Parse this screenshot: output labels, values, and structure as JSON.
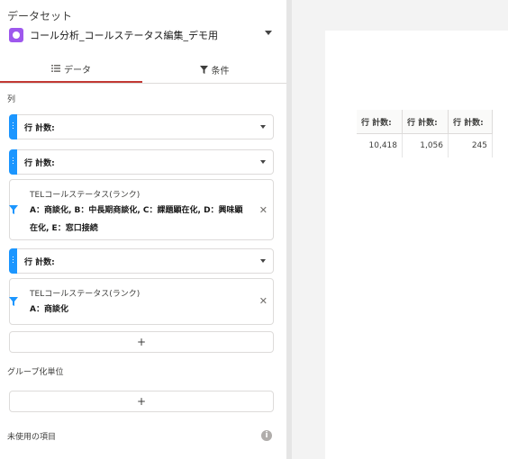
{
  "left_panel": {
    "dataset_label": "データセット",
    "dataset_name": "コール分析_コールステータス編集_デモ用",
    "tabs": [
      {
        "label": "データ",
        "active": true
      },
      {
        "label": "条件",
        "active": false
      }
    ],
    "columns_label": "列",
    "pills": [
      {
        "label": "行 計数:"
      },
      {
        "label": "行 計数:"
      },
      {
        "label": "行 計数:"
      }
    ],
    "filters": [
      {
        "title": "TELコールステータス(ランク)",
        "line1": "A：商談化, B：中長期商談化, C：課題顕在化, D：興味顕",
        "line2": "在化, E：窓口接続"
      },
      {
        "title": "TELコールステータス(ランク)",
        "line1": "A：商談化"
      }
    ],
    "add_button_label": "+",
    "group_by_label": "グループ化単位",
    "unused_label": "未使用の項目",
    "info_icon_glyph": "i"
  },
  "table": {
    "headers": [
      "行 計数:",
      "行 計数:",
      "行 計数:"
    ],
    "rows": [
      [
        "10,418",
        "1,056",
        "245"
      ]
    ]
  },
  "colors": {
    "accent_blue": "#1b96ff",
    "tab_underline": "#c23934",
    "dataset_icon": "#9e58ed"
  }
}
